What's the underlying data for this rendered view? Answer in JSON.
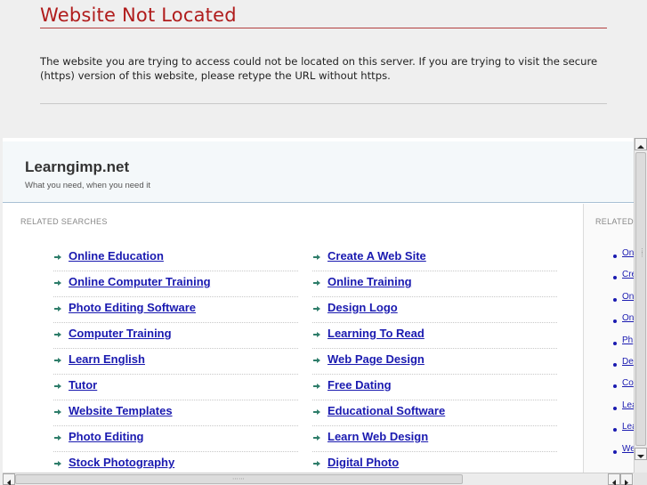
{
  "error": {
    "title": "Website Not Located",
    "message": "The website you are trying to access could not be located on this server. If you are trying to visit the secure (https) version of this website, please retype the URL without https."
  },
  "site": {
    "name": "Learngimp.net",
    "tagline": "What you need, when you need it"
  },
  "main": {
    "label": "RELATED SEARCHES",
    "left": [
      "Online Education",
      "Online Computer Training",
      "Photo Editing Software",
      "Computer Training",
      "Learn English",
      "Tutor",
      "Website Templates",
      "Photo Editing",
      "Stock Photography"
    ],
    "right": [
      "Create A Web Site",
      "Online Training",
      "Design Logo",
      "Learning To Read",
      "Web Page Design",
      "Free Dating",
      "Educational Software",
      "Learn Web Design",
      "Digital Photo"
    ]
  },
  "sidebar": {
    "label": "RELATED",
    "items": [
      "On",
      "Cre",
      "On",
      "On",
      "Ph",
      "De",
      "Co",
      "Lea",
      "Lea",
      "We"
    ]
  },
  "colors": {
    "error_title": "#b01c1c",
    "link": "#1a1ab0",
    "arrow": "#2e7d6a"
  }
}
